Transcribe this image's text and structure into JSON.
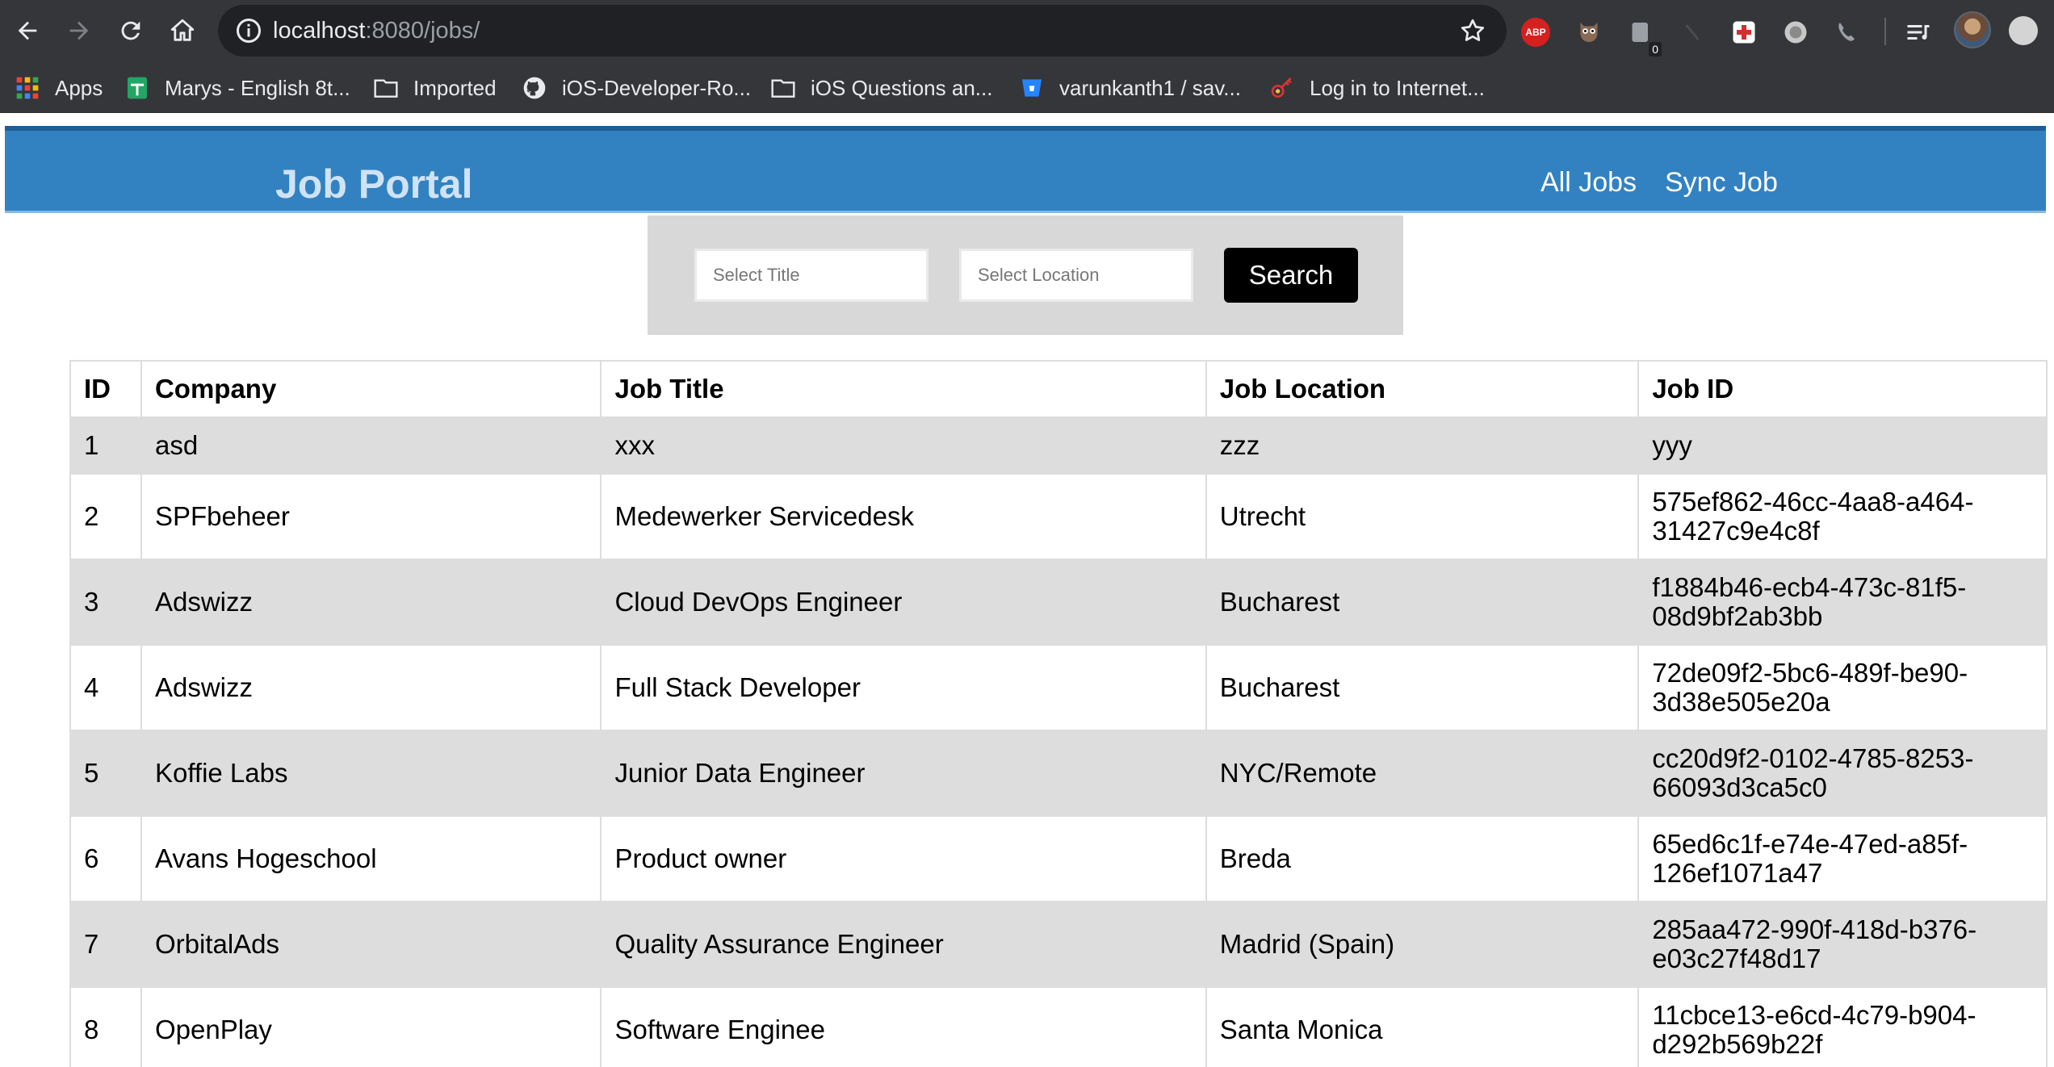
{
  "browser": {
    "url_host": "localhost",
    "url_path": ":8080/jobs/",
    "extensions": {
      "abp_label": "ABP",
      "counter_badge": "0"
    }
  },
  "bookmarks": [
    {
      "label": "Apps",
      "icon": "apps-grid-icon"
    },
    {
      "label": "Marys - English 8t...",
      "icon": "sheets-icon"
    },
    {
      "label": "Imported",
      "icon": "folder-icon"
    },
    {
      "label": "iOS-Developer-Ro...",
      "icon": "github-icon"
    },
    {
      "label": "iOS Questions an...",
      "icon": "folder-icon"
    },
    {
      "label": "varunkanth1 / sav...",
      "icon": "bitbucket-icon"
    },
    {
      "label": "Log in to Internet...",
      "icon": "login-icon"
    }
  ],
  "header": {
    "brand": "Job Portal",
    "nav": [
      "All Jobs",
      "Sync Job"
    ]
  },
  "search": {
    "title_placeholder": "Select Title",
    "location_placeholder": "Select Location",
    "button_label": "Search"
  },
  "table": {
    "columns": [
      "ID",
      "Company",
      "Job Title",
      "Job Location",
      "Job ID"
    ],
    "rows": [
      [
        "1",
        "asd",
        "xxx",
        "zzz",
        "yyy"
      ],
      [
        "2",
        "SPFbeheer",
        "Medewerker Servicedesk",
        "Utrecht",
        "575ef862-46cc-4aa8-a464-31427c9e4c8f"
      ],
      [
        "3",
        "Adswizz",
        "Cloud DevOps Engineer",
        "Bucharest",
        "f1884b46-ecb4-473c-81f5-08d9bf2ab3bb"
      ],
      [
        "4",
        "Adswizz",
        "Full Stack Developer",
        "Bucharest",
        "72de09f2-5bc6-489f-be90-3d38e505e20a"
      ],
      [
        "5",
        "Koffie Labs",
        "Junior Data Engineer",
        "NYC/Remote",
        "cc20d9f2-0102-4785-8253-66093d3ca5c0"
      ],
      [
        "6",
        "Avans Hogeschool",
        "Product owner",
        "Breda",
        "65ed6c1f-e74e-47ed-a85f-126ef1071a47"
      ],
      [
        "7",
        "OrbitalAds",
        "Quality Assurance Engineer",
        "Madrid (Spain)",
        "285aa472-990f-418d-b376-e03c27f48d17"
      ],
      [
        "8",
        "OpenPlay",
        "Software Enginee",
        "Santa Monica",
        "11cbce13-e6cd-4c79-b904-d292b569b22f"
      ]
    ]
  },
  "colors": {
    "chrome_bg": "#35363a",
    "omnibox_bg": "#202124",
    "navbar_bg": "#3282c2",
    "striped_row": "#dddddd",
    "search_panel": "#d8d8d8"
  }
}
